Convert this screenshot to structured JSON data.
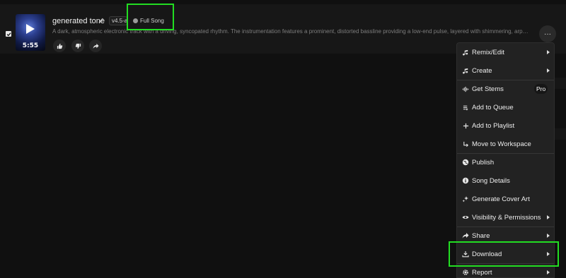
{
  "song": {
    "title": "generated tone",
    "version": "v4.5-all",
    "tag": "Full Song",
    "duration": "5:55",
    "description": "A dark, atmospheric electronic track with a driving, syncopated rhythm. The instrumentation features a prominent, distorted bassline providing a low-end pulse, layered with shimmering, arpeggiated synthes...",
    "more_label": "···"
  },
  "menu": {
    "items": [
      {
        "label": "Remix/Edit",
        "icon": "remix-icon",
        "submenu": true
      },
      {
        "label": "Create",
        "icon": "music-note-icon",
        "submenu": true
      },
      {
        "label": "Get Stems",
        "icon": "stems-icon",
        "badge": "Pro"
      },
      {
        "label": "Add to Queue",
        "icon": "queue-icon"
      },
      {
        "label": "Add to Playlist",
        "icon": "plus-icon"
      },
      {
        "label": "Move to Workspace",
        "icon": "move-icon"
      },
      {
        "label": "Publish",
        "icon": "globe-icon"
      },
      {
        "label": "Song Details",
        "icon": "info-icon"
      },
      {
        "label": "Generate Cover Art",
        "icon": "sparkle-icon"
      },
      {
        "label": "Visibility & Permissions",
        "icon": "eye-icon",
        "submenu": true
      },
      {
        "label": "Share",
        "icon": "share-icon",
        "submenu": true
      },
      {
        "label": "Download",
        "icon": "download-icon",
        "submenu": true
      },
      {
        "label": "Report",
        "icon": "report-icon",
        "submenu": true
      }
    ]
  },
  "colors": {
    "background": "#101010",
    "menu_background": "#222222",
    "highlight": "#22dd22"
  }
}
